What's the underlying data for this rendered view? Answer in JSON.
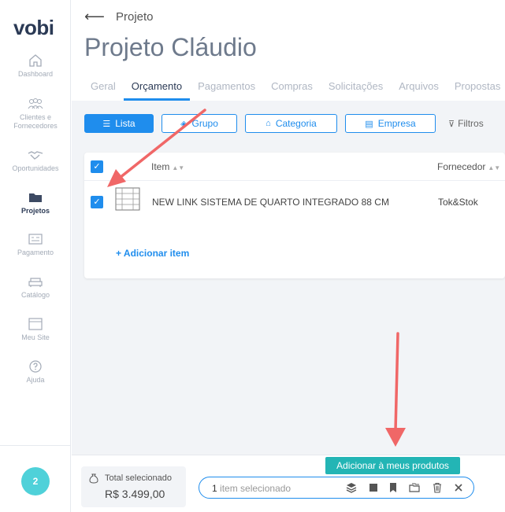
{
  "app": {
    "logo": "vobi"
  },
  "sidebar": {
    "items": [
      {
        "label": "Dashboard",
        "icon": "home-icon"
      },
      {
        "label": "Clientes e Fornecedores",
        "icon": "users-icon"
      },
      {
        "label": "Oportunidades",
        "icon": "handshake-icon"
      },
      {
        "label": "Projetos",
        "icon": "folder-icon",
        "active": true
      },
      {
        "label": "Pagamento",
        "icon": "payment-icon"
      },
      {
        "label": "Catálogo",
        "icon": "sofa-icon"
      },
      {
        "label": "Meu Site",
        "icon": "browser-icon"
      },
      {
        "label": "Ajuda",
        "icon": "help-icon"
      }
    ],
    "avatar": "2"
  },
  "header": {
    "breadcrumb": "Projeto",
    "title": "Projeto Cláudio"
  },
  "tabs": [
    "Geral",
    "Orçamento",
    "Pagamentos",
    "Compras",
    "Solicitações",
    "Arquivos",
    "Propostas"
  ],
  "toolbar": {
    "list": "Lista",
    "group": "Grupo",
    "category": "Categoria",
    "company": "Empresa",
    "filters": "Filtros"
  },
  "table": {
    "headers": {
      "item": "Item",
      "supplier": "Fornecedor"
    },
    "rows": [
      {
        "name": "NEW LINK SISTEMA DE QUARTO INTEGRADO 88 CM",
        "supplier": "Tok&Stok",
        "checked": true
      }
    ],
    "add_item": "+ Adicionar item"
  },
  "bottom": {
    "total_label": "Total selecionado",
    "total_value": "R$ 3.499,00",
    "selected_count": "1",
    "selected_text": "item selecionado",
    "tooltip": "Adicionar à meus produtos"
  },
  "colors": {
    "accent": "#1f8ded",
    "tooltip": "#23b5b5",
    "arrow": "#f06767"
  }
}
